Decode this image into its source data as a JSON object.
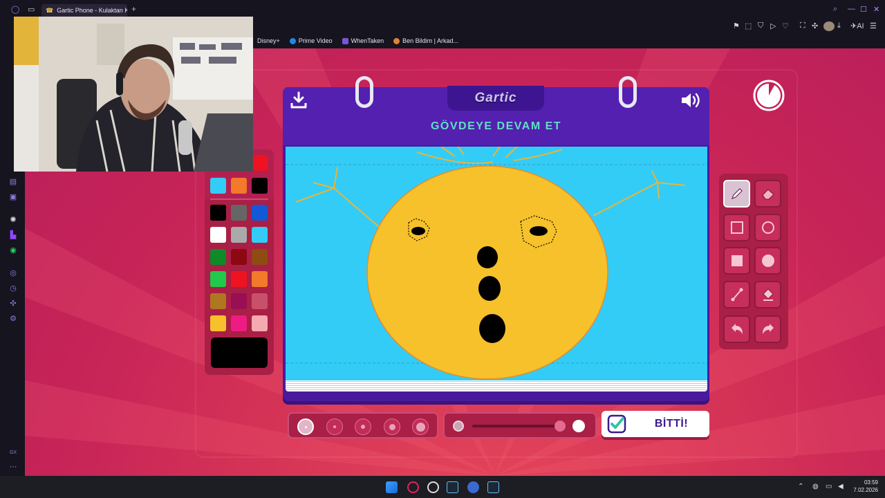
{
  "browser": {
    "tab_title": "Gartic Phone - Kulaktan Ku",
    "new_tab": "+",
    "bookmarks": [
      {
        "label": "Disney+",
        "color": "#1f3ca6"
      },
      {
        "label": "Prime Video",
        "color": "#1e88e5"
      },
      {
        "label": "WhenTaken",
        "color": "#7a55d6"
      },
      {
        "label": "Ben Bildim | Arkad...",
        "color": "#e0823a"
      }
    ],
    "toolbar_ai": "AI"
  },
  "game": {
    "logo": "Gartic",
    "prompt": "GÖVDEYE DEVAM ET",
    "done_label": "BİTTİ!",
    "timer_fraction_remaining": 0.92,
    "brush_sizes": [
      "size-1",
      "size-2",
      "size-3",
      "size-4",
      "size-5"
    ],
    "selected_brush_size": 1,
    "current_color": "#000000",
    "palette": [
      [
        "#33ccf7",
        "#f27a2a",
        "#000000"
      ],
      [
        "#000000",
        "#666666",
        "#1358d6"
      ],
      [
        "#ffffff",
        "#aaaaaa",
        "#33ccf7"
      ],
      [
        "#0e8a28",
        "#8c0812",
        "#8e4b12"
      ],
      [
        "#22c94b",
        "#ee1322",
        "#f27a2a"
      ],
      [
        "#b07722",
        "#990f53",
        "#c9506a"
      ],
      [
        "#f6c12a",
        "#ee1c82",
        "#f5aab0"
      ]
    ],
    "partial_top_color": "#ee1322",
    "tools": [
      "pencil",
      "eraser",
      "rectangle-outline",
      "ellipse-outline",
      "rectangle-fill",
      "ellipse-fill",
      "line",
      "fill-bucket",
      "undo",
      "redo"
    ],
    "active_tool": "pencil"
  },
  "system": {
    "time": "03:59",
    "date": "7.02.2026"
  }
}
